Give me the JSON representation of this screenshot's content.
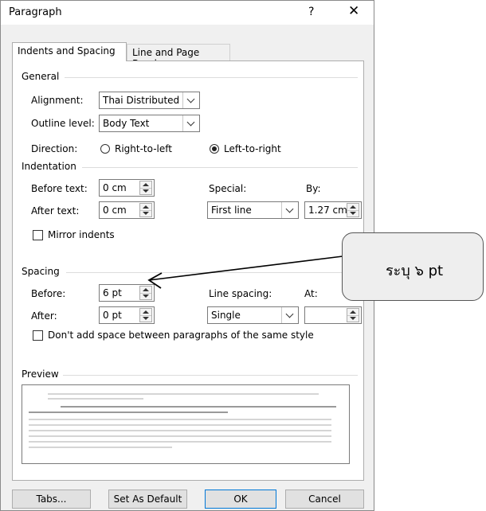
{
  "window": {
    "title": "Paragraph",
    "help": "?",
    "close": "✕"
  },
  "tabs": [
    {
      "label": "Indents and Spacing"
    },
    {
      "label": "Line and Page Breaks"
    }
  ],
  "general": {
    "heading": "General",
    "alignment_label": "Alignment:",
    "alignment_value": "Thai Distributed",
    "outline_label": "Outline level:",
    "outline_value": "Body Text",
    "direction_label": "Direction:",
    "rtl_label": "Right-to-left",
    "ltr_label": "Left-to-right",
    "selected_direction": "Left-to-right"
  },
  "indentation": {
    "heading": "Indentation",
    "before_label": "Before text:",
    "before_value": "0 cm",
    "after_label": "After text:",
    "after_value": "0 cm",
    "special_label": "Special:",
    "special_value": "First line",
    "by_label": "By:",
    "by_value": "1.27 cm",
    "mirror_label": "Mirror indents",
    "mirror_checked": false
  },
  "spacing": {
    "heading": "Spacing",
    "before_label": "Before:",
    "before_value": "6 pt",
    "after_label": "After:",
    "after_value": "0 pt",
    "line_spacing_label": "Line spacing:",
    "line_spacing_value": "Single",
    "at_label": "At:",
    "at_value": "",
    "dont_add_label": "Don't add space between paragraphs of the same style",
    "dont_add_checked": false
  },
  "preview": {
    "heading": "Preview"
  },
  "buttons": {
    "tabs": "Tabs...",
    "set_default": "Set As Default",
    "ok": "OK",
    "cancel": "Cancel"
  },
  "annotation": {
    "text": "ระบุ ๖ pt"
  }
}
